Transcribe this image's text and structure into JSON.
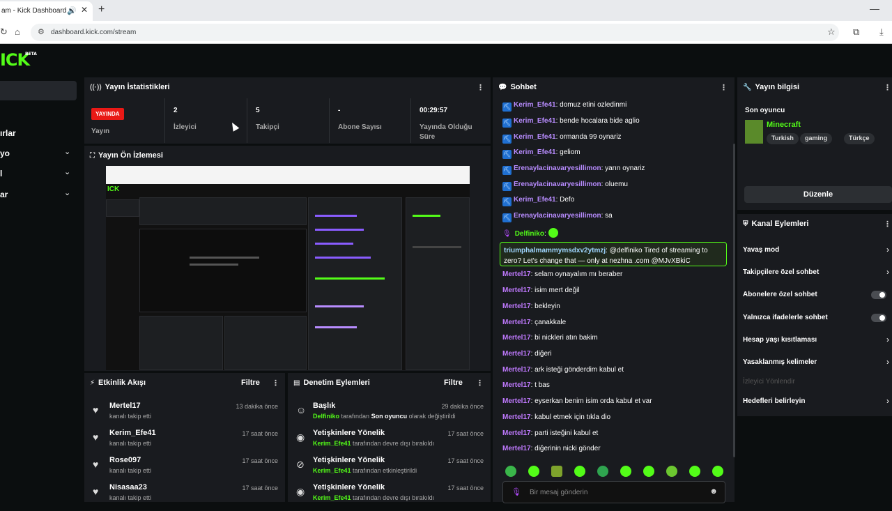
{
  "browser": {
    "tab_title": "am - Kick Dashboard",
    "url": "dashboard.kick.com/stream",
    "new_tab": "+",
    "close": "✕"
  },
  "logo": "ICK",
  "sidebar": {
    "items": [
      {
        "label": "ırlar"
      },
      {
        "label": "yo"
      },
      {
        "label": "l"
      },
      {
        "label": "ar"
      }
    ]
  },
  "stats_panel": {
    "title": "Yayın İstatistikleri",
    "live_badge": "YAYINDA",
    "live_label": "Yayın",
    "viewers_value": "2",
    "viewers_label": "İzleyici",
    "followers_value": "5",
    "followers_label": "Takipçi",
    "subs_value": "-",
    "subs_label": "Abone Sayısı",
    "uptime_value": "00:29:57",
    "uptime_label": "Yayında Olduğu Süre"
  },
  "preview_panel": {
    "title": "Yayın Ön İzlemesi"
  },
  "activity_panel": {
    "title": "Etkinlik Akışı",
    "filter": "Filtre",
    "items": [
      {
        "name": "Mertel17",
        "sub": "kanalı takip etti",
        "time": "13 dakika önce"
      },
      {
        "name": "Kerim_Efe41",
        "sub": "kanalı takip etti",
        "time": "17 saat önce"
      },
      {
        "name": "Rose097",
        "sub": "kanalı takip etti",
        "time": "17 saat önce"
      },
      {
        "name": "Nisasaa23",
        "sub": "kanalı takip etti",
        "time": "17 saat önce"
      }
    ]
  },
  "mod_panel": {
    "title": "Denetim Eylemleri",
    "filter": "Filtre",
    "items": [
      {
        "name": "Başlık",
        "actor": "Delfiniko",
        "mid": " tarafından ",
        "target": "Son oyuncu",
        "end": " olarak değiştirildi",
        "time": "29 dakika önce"
      },
      {
        "name": "Yetişkinlere Yönelik",
        "actor": "Kerim_Efe41",
        "mid": " tarafından devre dışı bırakıldı",
        "target": "",
        "end": "",
        "time": "17 saat önce"
      },
      {
        "name": "Yetişkinlere Yönelik",
        "actor": "Kerim_Efe41",
        "mid": " tarafından etkinleştirildi",
        "target": "",
        "end": "",
        "time": "17 saat önce"
      },
      {
        "name": "Yetişkinlere Yönelik",
        "actor": "Kerim_Efe41",
        "mid": " tarafından devre dışı bırakıldı",
        "target": "",
        "end": "",
        "time": "17 saat önce"
      }
    ]
  },
  "chat": {
    "title": "Sohbet",
    "messages": [
      {
        "user": "Kerim_Efe41",
        "text": ": domuz etini ozledinmi",
        "style": "u1",
        "badge": true
      },
      {
        "user": "Kerim_Efe41",
        "text": ": bende hocalara bide aglio",
        "style": "u1",
        "badge": true
      },
      {
        "user": "Kerim_Efe41",
        "text": ": ormanda 99 oynariz",
        "style": "u1",
        "badge": true
      },
      {
        "user": "Kerim_Efe41",
        "text": ": geliom",
        "style": "u1",
        "badge": true
      },
      {
        "user": "Erenaylacinavaryesillimon",
        "text": ": yarın oynariz",
        "style": "u1",
        "badge": true
      },
      {
        "user": "Erenaylacinavaryesillimon",
        "text": ": oluemu",
        "style": "u1",
        "badge": true
      },
      {
        "user": "Kerim_Efe41",
        "text": ": Defo",
        "style": "u1",
        "badge": true
      },
      {
        "user": "Erenaylacinavaryesillimon",
        "text": ": sa",
        "style": "u1",
        "badge": true
      },
      {
        "user": "Delfiniko",
        "text": ":",
        "style": "u3",
        "badge": false
      }
    ],
    "highlight": {
      "user": "triumphalmammymsdxv2ytmzj",
      "text": ": @delfiniko Tired of streaming to zero? Let's change that — only at nezhna .com @MJvXBkiC"
    },
    "messages2": [
      {
        "user": "Mertel17",
        "text": ": selam oynayalım mı beraber"
      },
      {
        "user": "Mertel17",
        "text": ": isim mert değil"
      },
      {
        "user": "Mertel17",
        "text": ": bekleyin"
      },
      {
        "user": "Mertel17",
        "text": ": çanakkale"
      },
      {
        "user": "Mertel17",
        "text": ": bi nickleri atın bakim"
      },
      {
        "user": "Mertel17",
        "text": ": diğeri"
      },
      {
        "user": "Mertel17",
        "text": ": ark isteği gönderdim kabul et"
      },
      {
        "user": "Mertel17",
        "text": ": t bas"
      },
      {
        "user": "Mertel17",
        "text": ": eyserkan benim isim orda kabul et var"
      },
      {
        "user": "Mertel17",
        "text": ": kabul etmek için tıkla dio"
      },
      {
        "user": "Mertel17",
        "text": ": parti isteğini kabul et"
      },
      {
        "user": "Mertel17",
        "text": ": diğerinin nicki gönder"
      }
    ],
    "input_placeholder": "Bir mesaj gönderin"
  },
  "stream_info": {
    "title": "Yayın bilgisi",
    "subtitle": "Son oyuncu",
    "category": "Minecraft",
    "tags": [
      "Turkish",
      "gaming",
      "Türkçe"
    ],
    "edit": "Düzenle"
  },
  "channel_actions": {
    "title": "Kanal Eylemleri",
    "items": [
      {
        "label": "Yavaş mod",
        "kind": "chev"
      },
      {
        "label": "Takipçilere özel sohbet",
        "kind": "chev"
      },
      {
        "label": "Abonelere özel sohbet",
        "kind": "toggle"
      },
      {
        "label": "Yalnızca ifadelerle sohbet",
        "kind": "toggle"
      },
      {
        "label": "Hesap yaşı kısıtlaması",
        "kind": "chev"
      },
      {
        "label": "Yasaklanmış kelimeler",
        "kind": "chev"
      },
      {
        "label": "İzleyici Yönlendir",
        "kind": "dim"
      },
      {
        "label": "Hedefleri belirleyin",
        "kind": "chev"
      }
    ]
  },
  "colors": {
    "brand": "#53fc18",
    "live": "#e91916",
    "panel": "#191b1f",
    "background": "#0b0e0f"
  }
}
